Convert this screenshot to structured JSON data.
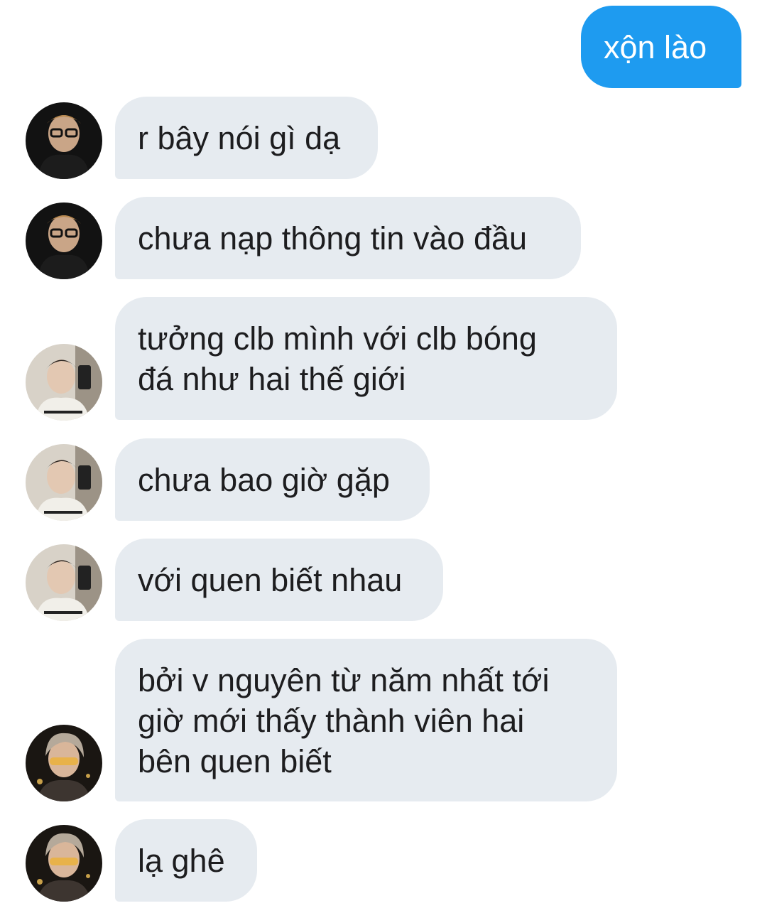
{
  "conversation": {
    "outgoing": [
      {
        "text": "xộn lào"
      }
    ],
    "incoming": [
      {
        "sender": "user-a",
        "lines": [
          "r bây nói gì dạ"
        ]
      },
      {
        "sender": "user-a",
        "lines": [
          "chưa nạp thông tin vào đầu"
        ]
      },
      {
        "sender": "user-b",
        "lines": [
          "tưởng clb mình với clb bóng",
          "đá như hai thế giới"
        ]
      },
      {
        "sender": "user-b",
        "lines": [
          "chưa bao giờ gặp"
        ]
      },
      {
        "sender": "user-b",
        "lines": [
          "với quen biết nhau"
        ]
      },
      {
        "sender": "user-c",
        "lines": [
          "bởi v nguyên từ năm nhất tới",
          "giờ mới thấy thành viên hai",
          "bên quen biết"
        ]
      },
      {
        "sender": "user-c",
        "lines": [
          "lạ ghê"
        ]
      }
    ]
  },
  "colors": {
    "outgoing_bubble": "#1e9bf0",
    "incoming_bubble": "#e6ebf0",
    "text_dark": "#1d1d1f",
    "text_light": "#ffffff"
  }
}
